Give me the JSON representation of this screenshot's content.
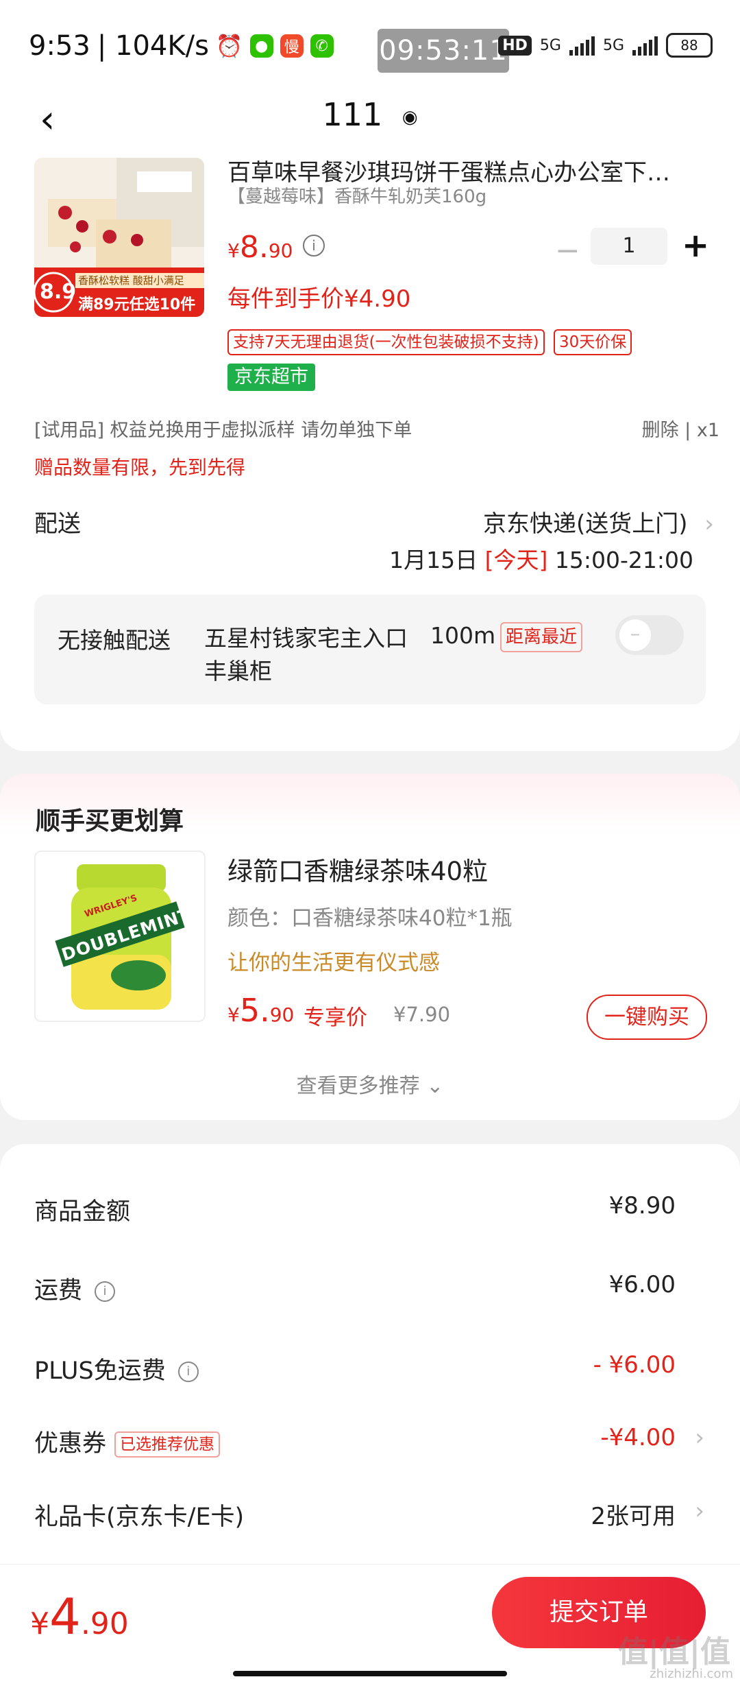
{
  "status_bar": {
    "time": "9:53",
    "net_speed": "| 104K/s",
    "clock_overlay": "09:53:11",
    "hd": "HD",
    "net1": "5G",
    "net2": "5G",
    "battery": "88",
    "slow_label": "慢"
  },
  "header": {
    "title": "111"
  },
  "product": {
    "name": "百草味早餐沙琪玛饼干蛋糕点心办公室下…",
    "spec": "【蔓越莓味】香酥牛轧奶芙160g",
    "price_int": "8.",
    "price_dec": "90",
    "currency": "¥",
    "quantity": "1",
    "unit_price": "每件到手价¥4.90",
    "tag_return": "支持7天无理由退货(一次性包装破损不支持)",
    "tag_price_protect": "30天价保",
    "tag_store": "京东超市",
    "image_badge_price": "8.9",
    "image_badge_promo": "满89元任选10件",
    "image_caption": "香酥松软糕 酸甜小满足"
  },
  "trial": {
    "text": "[试用品]   权益兑换用于虚拟派样 请勿单独下单",
    "right": "删除 | x1"
  },
  "gift_note": "赠品数量有限，先到先得",
  "delivery": {
    "label": "配送",
    "method": "京东快递(送货上门)",
    "date": "1月15日",
    "today": "[今天]",
    "window": "15:00-21:00"
  },
  "no_contact": {
    "label": "无接触配送",
    "address": "五星村钱家宅主入口丰巢柜",
    "distance": "100m",
    "tag": "距离最近"
  },
  "recommend": {
    "title": "顺手买更划算",
    "name": "绿箭口香糖绿茶味40粒",
    "spec": "颜色：口香糖绿茶味40粒*1瓶",
    "slogan": "让你的生活更有仪式感",
    "price_int": "5.",
    "price_dec": "90",
    "exclusive": "专享价",
    "orig_price": "¥7.90",
    "buy_button": "一键购买",
    "more": "查看更多推荐 ⌄",
    "brand": "DOUBLEMINT",
    "maker": "WRIGLEY'S"
  },
  "fees": {
    "goods_label": "商品金额",
    "goods_val": "¥8.90",
    "shipping_label": "运费",
    "shipping_val": "¥6.00",
    "plus_label": "PLUS免运费",
    "plus_val": "- ¥6.00",
    "coupon_label": "优惠券",
    "coupon_tag": "已选推荐优惠",
    "coupon_val": "-¥4.00",
    "giftcard_label": "礼品卡(京东卡/E卡)",
    "giftcard_val": "2张可用"
  },
  "bottom": {
    "total_currency": "¥",
    "total_int": "4",
    "total_dec": ".90",
    "submit": "提交订单"
  },
  "watermark": {
    "main": "值|值|值",
    "sub": "zhizhizhi.com"
  },
  "colors": {
    "accent": "#e2231a",
    "green": "#20b04b",
    "gold": "#c98a27"
  }
}
